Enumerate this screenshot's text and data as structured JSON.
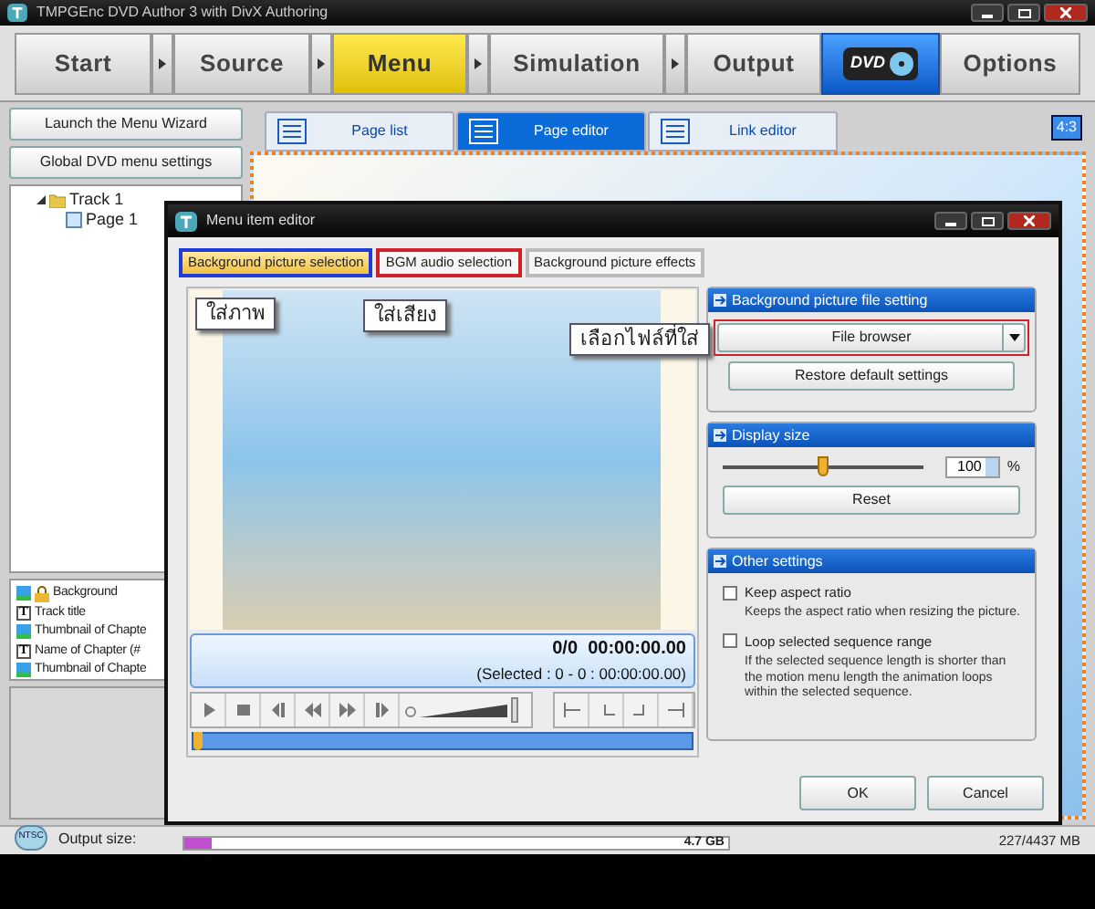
{
  "window": {
    "title": "TMPGEnc DVD Author 3 with DivX Authoring"
  },
  "steps": [
    {
      "label": "Start",
      "kind": "step",
      "selected": false
    },
    {
      "label": "Source",
      "kind": "step",
      "selected": false
    },
    {
      "label": "Menu",
      "kind": "step",
      "selected": true
    },
    {
      "label": "Simulation",
      "kind": "step",
      "selected": false
    },
    {
      "label": "Output",
      "kind": "step",
      "selected": false
    },
    {
      "label": "DVD",
      "kind": "logo",
      "selected": false
    },
    {
      "label": "Options",
      "kind": "step",
      "selected": false
    }
  ],
  "left_panel": {
    "buttons": [
      "Launch the Menu Wizard",
      "Global DVD menu settings"
    ],
    "tree": [
      {
        "label": "Track 1",
        "expanded": true,
        "children": [
          {
            "label": "Page 1"
          }
        ]
      }
    ],
    "layers": [
      {
        "label": "Background",
        "kind": "image",
        "locked": true
      },
      {
        "label": "Track title",
        "kind": "text",
        "icon_label": "T",
        "locked": false
      },
      {
        "label": "Thumbnail of Chapte",
        "kind": "image",
        "locked": false
      },
      {
        "label": "Name of Chapter (#",
        "kind": "text",
        "icon_label": "T",
        "locked": false
      },
      {
        "label": "Thumbnail of Chapte",
        "kind": "image",
        "locked": false
      }
    ]
  },
  "editor_tabs": [
    {
      "label": "Page list",
      "selected": false
    },
    {
      "label": "Page editor",
      "selected": true
    },
    {
      "label": "Link editor",
      "selected": false
    }
  ],
  "aspect_badge": "4:3",
  "dialog": {
    "title": "Menu item editor",
    "tabs": [
      {
        "label": "Background picture selection",
        "selected": true,
        "color": "#1e3cd8"
      },
      {
        "label": "BGM audio selection",
        "selected": false,
        "color": "#d0202a"
      },
      {
        "label": "Background picture effects",
        "selected": false
      }
    ],
    "callouts": [
      "ใส่ภาพ",
      "ใส่เสียง",
      "เลือกไฟล์ที่ใส่"
    ],
    "time": "0/0  00:00:00.00",
    "selected_range": "(Selected : 0 - 0 : 00:00:00.00)",
    "volume": {
      "level": 0.95
    },
    "seek": {
      "level": 0
    },
    "sections": [
      {
        "title": "Background picture file setting",
        "kind": "file",
        "dropdown": {
          "label": "File browser",
          "highlighted": true
        },
        "button": "Restore default settings"
      },
      {
        "title": "Display size",
        "kind": "size",
        "slider": {
          "level": 0.5
        },
        "value": "100",
        "unit": "%",
        "button": "Reset"
      },
      {
        "title": "Other settings",
        "kind": "options",
        "options": [
          {
            "label": "Keep aspect ratio",
            "checked": false,
            "description": "Keeps the aspect ratio when resizing the picture."
          },
          {
            "label": "Loop selected sequence range",
            "checked": false,
            "description": "If the selected sequence length is shorter than the motion menu length the animation loops within the selected sequence."
          }
        ]
      }
    ],
    "buttons": [
      "OK",
      "Cancel"
    ]
  },
  "status_bar": {
    "format": "NTSC",
    "label": "Output size:",
    "level": 0.05,
    "capacity": "4.7 GB",
    "usage": "227/4437 MB"
  }
}
